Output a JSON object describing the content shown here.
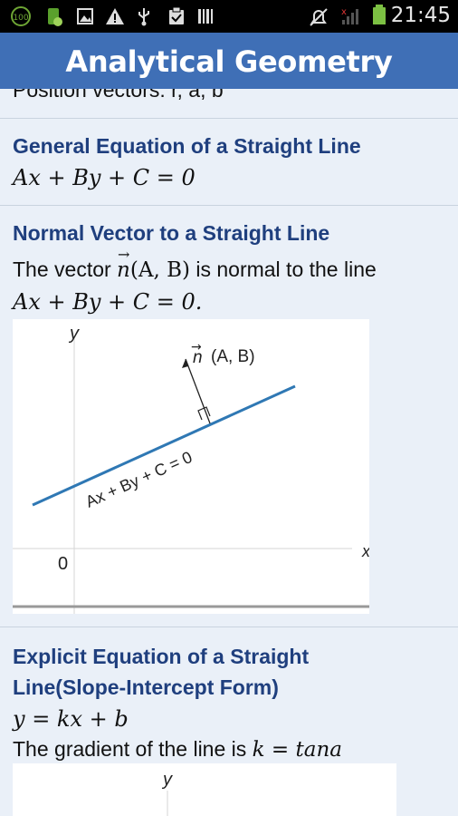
{
  "status_bar": {
    "time": "21:45",
    "icons": [
      "battery-100-icon",
      "android-debug-icon",
      "image-icon",
      "warning-icon",
      "usb-icon",
      "clipboard-check-icon",
      "barcode-icon",
      "alarm-off-icon",
      "signal-off-icon",
      "battery-icon"
    ]
  },
  "app": {
    "title": "Analytical Geometry"
  },
  "sections": {
    "prev": {
      "text": "Position vectors: r, a, b"
    },
    "general": {
      "heading": "General Equation of a Straight Line",
      "formula": "Ax + By + C = 0"
    },
    "normal": {
      "heading": "Normal Vector to a Straight Line",
      "text_before": "The vector",
      "vector_symbol": "n",
      "vector_args": "(A, B)",
      "text_after": "is normal to the line",
      "formula": "Ax + By + C = 0.",
      "figure": {
        "y_label": "y",
        "x_label": "x",
        "origin_label": "0",
        "vector_label": "(A, B)",
        "line_label": "Ax + By + C = 0"
      }
    },
    "explicit": {
      "heading_line1": "Explicit Equation of a Straight",
      "heading_line2": "Line(Slope-Intercept Form)",
      "formula": "y = kx + b",
      "text_prefix": "The gradient of the line is",
      "text_formula": "k = tana",
      "figure": {
        "y_label": "y"
      }
    }
  },
  "colors": {
    "accent": "#3f6fb6",
    "heading": "#1f3f7e",
    "line": "#2f78b4",
    "background": "#eaf0f8"
  }
}
